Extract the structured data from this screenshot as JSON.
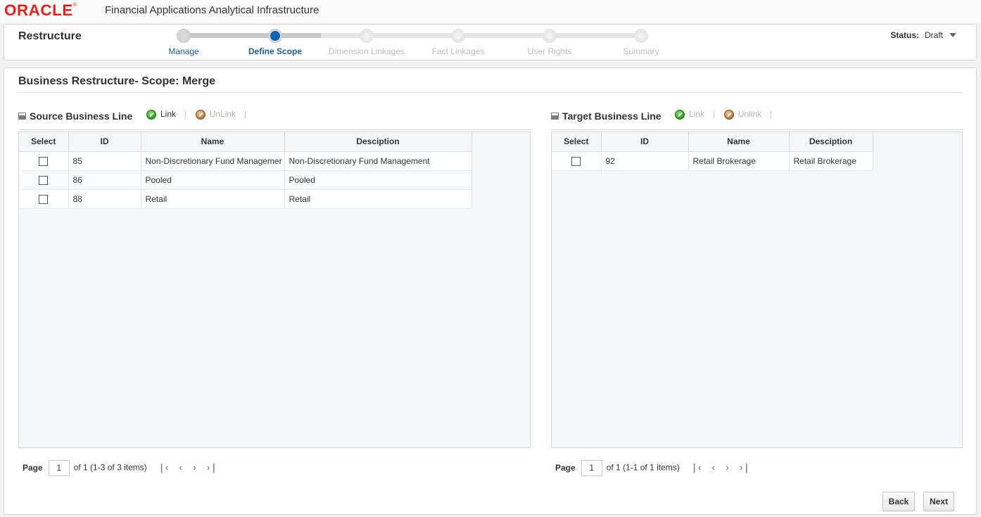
{
  "header": {
    "logo_text": "ORACLE",
    "logo_mark": "®",
    "app_title": "Financial Applications Analytical Infrastructure"
  },
  "train": {
    "title": "Restructure",
    "stops": [
      {
        "label": "Manage",
        "state": "visited"
      },
      {
        "label": "Define Scope",
        "state": "current"
      },
      {
        "label": "Dimension Linkages",
        "state": "unvisited"
      },
      {
        "label": "Fact Linkages",
        "state": "unvisited"
      },
      {
        "label": "User Rights",
        "state": "unvisited"
      },
      {
        "label": "Summary",
        "state": "unvisited"
      }
    ],
    "status_label": "Status:",
    "status_value": "Draft"
  },
  "main": {
    "title": "Business Restructure- Scope: Merge",
    "source": {
      "title": "Source Business Line",
      "link_label": "Link",
      "unlink_label": "UnLink",
      "columns": [
        "Select",
        "ID",
        "Name",
        "Desciption"
      ],
      "rows": [
        {
          "id": "85",
          "name": "Non-Discretionary Fund Managemer",
          "description": "Non-Discretionary Fund Management"
        },
        {
          "id": "86",
          "name": "Pooled",
          "description": "Pooled"
        },
        {
          "id": "88",
          "name": "Retail",
          "description": "Retail"
        }
      ],
      "pager": {
        "page_label": "Page",
        "page_value": "1",
        "of_text": "of 1",
        "items_text": "(1-3 of 3 items)"
      }
    },
    "target": {
      "title": "Target Business Line",
      "link_label": "Link",
      "unlink_label": "Unlink",
      "columns": [
        "Select",
        "ID",
        "Name",
        "Desciption"
      ],
      "rows": [
        {
          "id": "92",
          "name": "Retail Brokerage",
          "description": "Retail Brokerage"
        }
      ],
      "pager": {
        "page_label": "Page",
        "page_value": "1",
        "of_text": "of 1",
        "items_text": "(1-1 of 1 items)"
      }
    },
    "buttons": {
      "back": "Back",
      "next": "Next"
    }
  },
  "icons": {
    "pager_first": "first-page-icon",
    "pager_prev": "prev-page-icon",
    "pager_next": "next-page-icon",
    "pager_last": "last-page-icon"
  },
  "colors": {
    "brand": "#e4221b",
    "accent": "#0a64b4",
    "link_text": "#1f5a96"
  }
}
